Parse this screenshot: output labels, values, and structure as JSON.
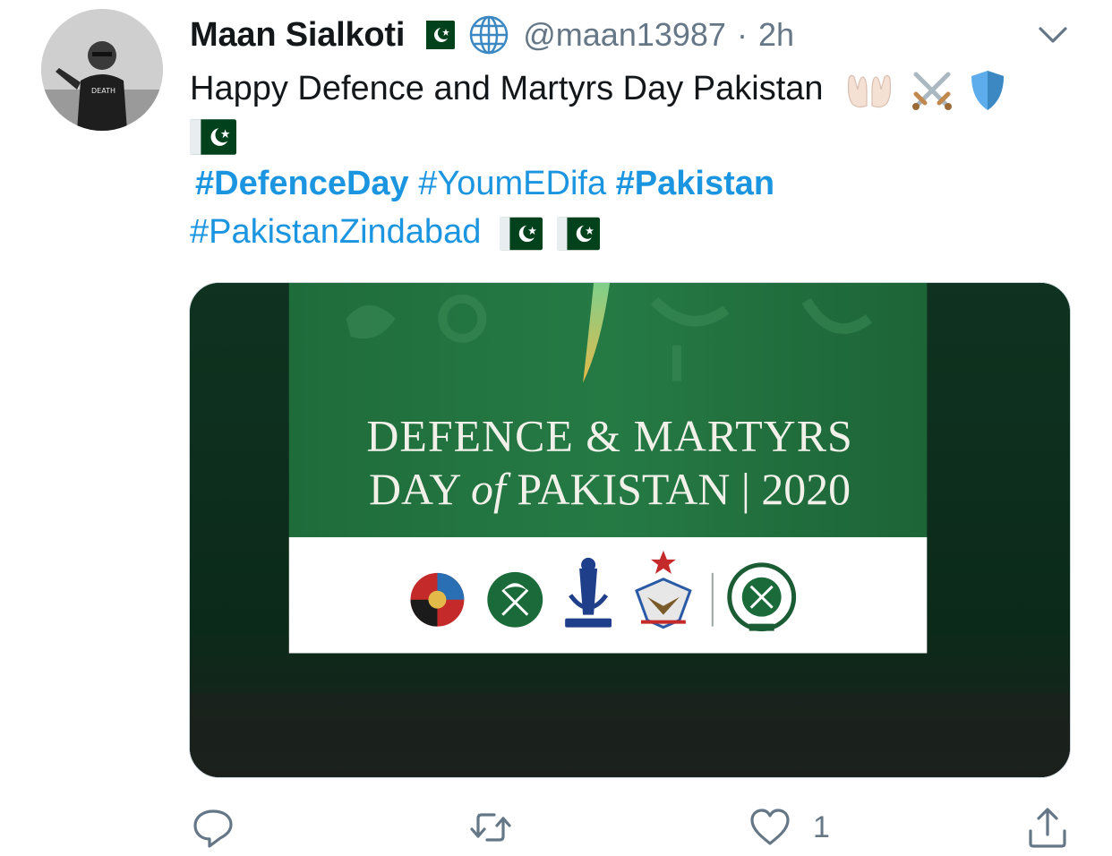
{
  "tweet": {
    "author": {
      "display_name": "Maan Sialkoti",
      "handle": "@maan13987",
      "separator": "·",
      "time": "2h",
      "avatar_shirt_text": "DEATH"
    },
    "text_line1": "Happy Defence and Martyrs Day Pakistan",
    "hashtags": {
      "defence_day": "#DefenceDay",
      "youm_e_difa": "#YoumEDifa",
      "pakistan": "#Pakistan",
      "pakistan_zindabad": "#PakistanZindabad"
    },
    "media": {
      "title_line1": "DEFENCE & MARTYRS",
      "title_line2_a": "DAY ",
      "title_line2_of": "of",
      "title_line2_b": " PAKISTAN | 2020"
    },
    "actions": {
      "like_count": "1"
    }
  },
  "icons": {
    "flag": "pakistan-flag-icon",
    "globe": "globe-icon",
    "caret": "chevron-down-icon",
    "reply": "reply-icon",
    "retweet": "retweet-icon",
    "like": "heart-icon",
    "share": "share-icon",
    "hands": "palms-up-together-icon",
    "swords": "crossed-swords-icon",
    "shield": "shield-icon"
  },
  "colors": {
    "text": "#14171a",
    "secondary": "#657786",
    "link": "#1b95e0",
    "flag_green": "#01411c",
    "media_green": "#1a6e3a"
  }
}
